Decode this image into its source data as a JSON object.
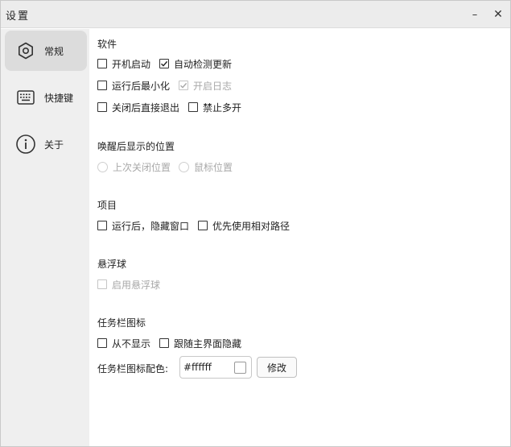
{
  "window": {
    "title": "设置",
    "minimize_glyph": "–",
    "close_glyph": "✕"
  },
  "sidebar": {
    "items": [
      {
        "label": "常规",
        "icon": "gear-icon",
        "active": true
      },
      {
        "label": "快捷键",
        "icon": "keyboard-icon",
        "active": false
      },
      {
        "label": "关于",
        "icon": "info-icon",
        "active": false
      }
    ]
  },
  "software": {
    "title": "软件",
    "options": [
      {
        "label": "开机启动",
        "checked": false,
        "enabled": true
      },
      {
        "label": "自动检测更新",
        "checked": true,
        "enabled": true
      },
      {
        "label": "运行后最小化",
        "checked": false,
        "enabled": true
      },
      {
        "label": "开启日志",
        "checked": true,
        "enabled": false
      },
      {
        "label": "关闭后直接退出",
        "checked": false,
        "enabled": true
      },
      {
        "label": "禁止多开",
        "checked": false,
        "enabled": true
      }
    ]
  },
  "wake_position": {
    "title": "唤醒后显示的位置",
    "options": [
      {
        "label": "上次关闭位置",
        "selected": false,
        "enabled": false
      },
      {
        "label": "鼠标位置",
        "selected": false,
        "enabled": false
      }
    ]
  },
  "project": {
    "title": "项目",
    "options": [
      {
        "label": "运行后，隐藏窗口",
        "checked": false,
        "enabled": true
      },
      {
        "label": "优先使用相对路径",
        "checked": false,
        "enabled": true
      }
    ]
  },
  "floating_ball": {
    "title": "悬浮球",
    "options": [
      {
        "label": "启用悬浮球",
        "checked": false,
        "enabled": false
      }
    ]
  },
  "tray_icon": {
    "title": "任务栏图标",
    "options": [
      {
        "label": "从不显示",
        "checked": false,
        "enabled": true
      },
      {
        "label": "跟随主界面隐藏",
        "checked": false,
        "enabled": true
      }
    ],
    "color_label": "任务栏图标配色:",
    "color_value": "#ffffff",
    "modify_button": "修改"
  }
}
